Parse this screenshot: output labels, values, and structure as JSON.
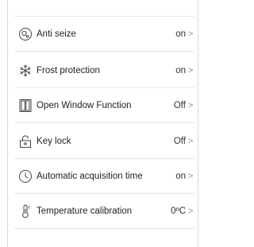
{
  "settings": {
    "items": [
      {
        "icon": "anti-seize-icon",
        "label": "Anti seize",
        "value": "on"
      },
      {
        "icon": "snowflake-icon",
        "label": "Frost protection",
        "value": "on"
      },
      {
        "icon": "window-icon",
        "label": "Open Window Function",
        "value": "Off"
      },
      {
        "icon": "lock-icon",
        "label": "Key lock",
        "value": "Off"
      },
      {
        "icon": "clock-icon",
        "label": "Automatic acquisition time",
        "value": "on"
      },
      {
        "icon": "thermometer-icon",
        "label": "Temperature calibration",
        "value": "0ºC"
      }
    ],
    "chevron": ">"
  },
  "colors": {
    "divider": "#e6e6e6",
    "text": "#222222",
    "chevron": "#8c8c8c"
  }
}
